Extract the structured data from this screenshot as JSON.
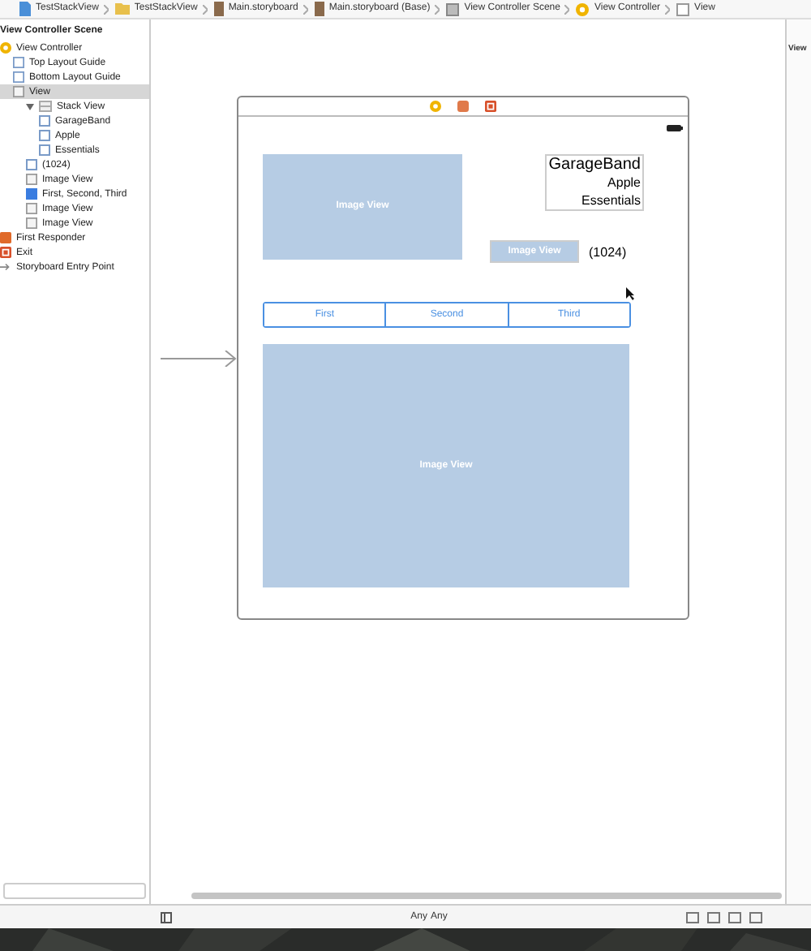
{
  "breadcrumbs": [
    {
      "label": "TestStackView",
      "kind": "project"
    },
    {
      "label": "TestStackView",
      "kind": "folder"
    },
    {
      "label": "Main.storyboard",
      "kind": "storyboard"
    },
    {
      "label": "Main.storyboard (Base)",
      "kind": "storyboard"
    },
    {
      "label": "View Controller Scene",
      "kind": "scene"
    },
    {
      "label": "View Controller",
      "kind": "controller"
    },
    {
      "label": "View",
      "kind": "view"
    }
  ],
  "outline": {
    "title": "View Controller Scene",
    "items": [
      {
        "label": "View Controller",
        "kind": "controller",
        "selected": false,
        "children": [
          {
            "label": "Top Layout Guide",
            "kind": "guide",
            "selected": false
          },
          {
            "label": "Bottom Layout Guide",
            "kind": "guide",
            "selected": false
          },
          {
            "label": "View",
            "kind": "view",
            "selected": true,
            "children": [
              {
                "label": "Stack View",
                "kind": "stack",
                "selected": false,
                "expanded": true,
                "children": [
                  {
                    "label": "GarageBand",
                    "kind": "label",
                    "selected": false
                  },
                  {
                    "label": "Apple",
                    "kind": "label",
                    "selected": false
                  },
                  {
                    "label": "Essentials",
                    "kind": "label",
                    "selected": false
                  }
                ]
              },
              {
                "label": "(1024)",
                "kind": "label",
                "selected": false
              },
              {
                "label": "Image View",
                "selected": false
              },
              {
                "label": "First, Second, Third",
                "kind": "segmented",
                "selected": false
              },
              {
                "label": "Image View",
                "selected": false
              },
              {
                "label": "Image View",
                "selected": false
              }
            ]
          }
        ]
      },
      {
        "label": "First Responder",
        "kind": "responder",
        "selected": false
      },
      {
        "label": "Exit",
        "kind": "exit",
        "selected": false
      },
      {
        "label": "Storyboard Entry Point",
        "kind": "entry",
        "selected": false
      }
    ]
  },
  "canvas": {
    "top_image": "Image View",
    "stack_labels": [
      "GarageBand",
      "Apple",
      "Essentials"
    ],
    "small_image": "Image View",
    "count_label": "(1024)",
    "segments": [
      {
        "label": "First",
        "selected": false
      },
      {
        "label": "Second",
        "selected": false
      },
      {
        "label": "Third",
        "selected": false
      }
    ],
    "bottom_image": "Image View"
  },
  "size_class": {
    "width": "Any",
    "height": "Any"
  },
  "inspector": {
    "title": "View"
  }
}
